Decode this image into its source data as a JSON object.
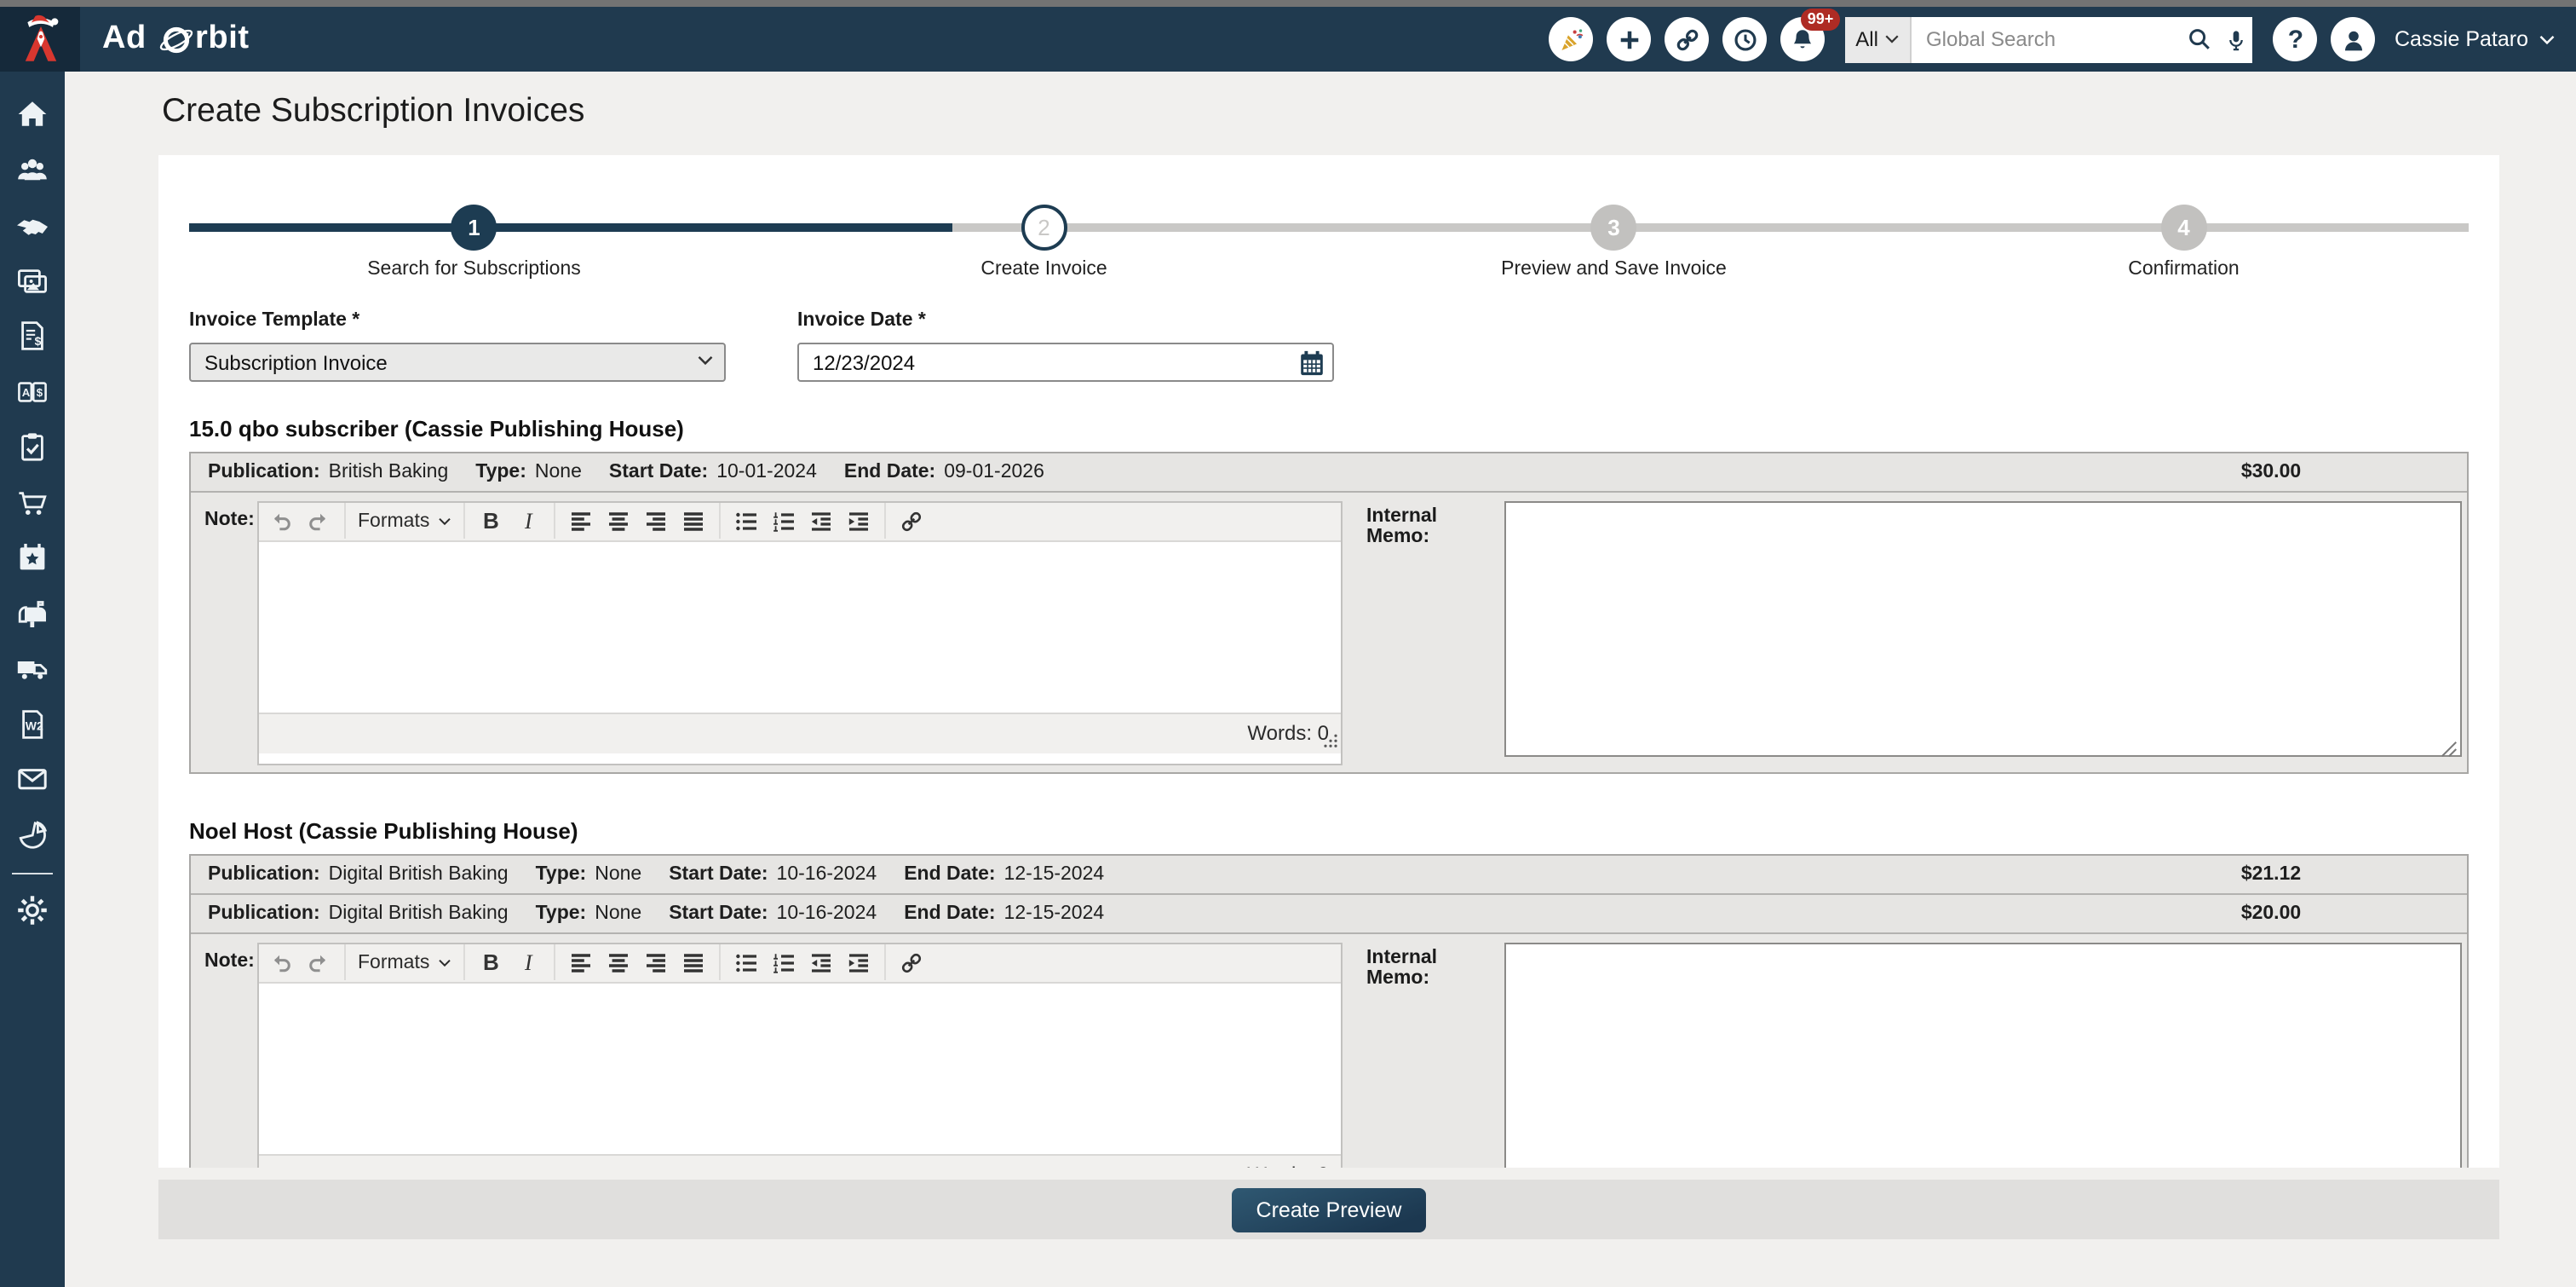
{
  "header": {
    "brand_prefix": "Ad ",
    "brand_suffix": "rbit",
    "brand": "Ad Orbit",
    "icons": [
      "party-popper",
      "plus",
      "link",
      "history",
      "notifications-bell",
      "help",
      "user-avatar"
    ],
    "notification_badge": "99+",
    "search": {
      "scope": "All",
      "placeholder": "Global Search"
    },
    "user_name": "Cassie Pataro"
  },
  "sidebar": {
    "items": [
      "home",
      "contacts",
      "partners-handshake",
      "media-library",
      "billing-invoices",
      "rate-book",
      "tasks-clipboard",
      "store-cart",
      "events-calendar",
      "direct-mailbox",
      "distribution-truck",
      "tax-forms-w2",
      "email",
      "reports-pie",
      "settings-gear"
    ]
  },
  "page": {
    "title": "Create Subscription Invoices"
  },
  "stepper": {
    "progress_pct": 33.5,
    "steps": [
      {
        "number": "1",
        "label": "Search for Subscriptions",
        "state": "active"
      },
      {
        "number": "2",
        "label": "Create Invoice",
        "state": "next"
      },
      {
        "number": "3",
        "label": "Preview and Save Invoice",
        "state": "upcoming"
      },
      {
        "number": "4",
        "label": "Confirmation",
        "state": "upcoming"
      }
    ]
  },
  "form": {
    "invoice_template": {
      "label": "Invoice Template *",
      "value": "Subscription Invoice"
    },
    "invoice_date": {
      "label": "Invoice Date *",
      "value": "12/23/2024"
    }
  },
  "row_labels": {
    "publication": "Publication:",
    "type": "Type:",
    "start": "Start Date:",
    "end": "End Date:"
  },
  "labels": {
    "note": "Note:",
    "internal_memo": "Internal Memo:",
    "words": "Words: 0",
    "formats": "Formats"
  },
  "sections": [
    {
      "title": "15.0 qbo subscriber (Cassie Publishing House)",
      "rows": [
        {
          "publication": "British Baking",
          "type": "None",
          "start": "10-01-2024",
          "end": "09-01-2026",
          "amount": "$30.00"
        }
      ]
    },
    {
      "title": "Noel Host (Cassie Publishing House)",
      "rows": [
        {
          "publication": "Digital British Baking",
          "type": "None",
          "start": "10-16-2024",
          "end": "12-15-2024",
          "amount": "$21.12"
        },
        {
          "publication": "Digital British Baking",
          "type": "None",
          "start": "10-16-2024",
          "end": "12-15-2024",
          "amount": "$20.00"
        }
      ]
    }
  ],
  "footer": {
    "create_preview": "Create Preview"
  },
  "colors": {
    "header_navy": "#203A4F",
    "accent_navy": "#1D3C52",
    "badge_red": "#AE2B24",
    "logo_red": "#D8372F",
    "page_bg": "#F1F0EE",
    "band_gray": "#E0DFDD"
  }
}
